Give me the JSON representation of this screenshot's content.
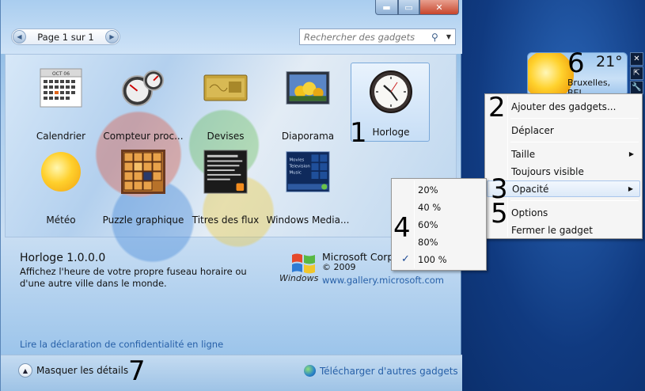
{
  "window": {
    "controls": {
      "minimize": "▬",
      "maximize": "▭",
      "close": "✕"
    }
  },
  "pager": {
    "label": "Page 1 sur 1"
  },
  "search": {
    "placeholder": "Rechercher des gadgets"
  },
  "gadgets": [
    {
      "label": "Calendrier",
      "icon": "calendar-icon",
      "month": "OCT 06"
    },
    {
      "label": "Compteur proc...",
      "icon": "cpu-meter-icon"
    },
    {
      "label": "Devises",
      "icon": "currency-card-icon"
    },
    {
      "label": "Diaporama",
      "icon": "slideshow-icon"
    },
    {
      "label": "Horloge",
      "icon": "clock-icon"
    },
    {
      "label": "Météo",
      "icon": "weather-sun-icon"
    },
    {
      "label": "Puzzle graphique",
      "icon": "picture-puzzle-icon"
    },
    {
      "label": "Titres des flux",
      "icon": "feed-headlines-icon"
    },
    {
      "label": "Windows Media...",
      "icon": "media-center-icon",
      "media_lines": [
        "Movies",
        "Television",
        "Music"
      ]
    }
  ],
  "details": {
    "title": "Horloge 1.0.0.0",
    "description": "Affichez l'heure de votre propre fuseau horaire ou d'une autre ville dans le monde.",
    "publisher": "Microsoft Corp",
    "year": "© 2009",
    "link": "www.gallery.microsoft.com",
    "ms_brand": "Windows"
  },
  "privacy_link": "Lire la déclaration de confidentialité en ligne",
  "footer": {
    "hide_details": "Masquer les détails",
    "download_more": "Télécharger d'autres gadgets"
  },
  "weather_gadget": {
    "temperature": "21°",
    "city": "Bruxelles, BEL"
  },
  "gadget_toolbar": {
    "close": "✕",
    "size": "⇱",
    "options": "🔧"
  },
  "context_menu": {
    "items": [
      {
        "label": "Ajouter des gadgets...",
        "submenu": false
      },
      {
        "label": "Déplacer",
        "submenu": false
      },
      {
        "label": "Taille",
        "submenu": true
      },
      {
        "label": "Toujours visible",
        "submenu": false
      },
      {
        "label": "Opacité",
        "submenu": true,
        "highlighted": true
      },
      {
        "label": "Options",
        "submenu": false
      },
      {
        "label": "Fermer le gadget",
        "submenu": false
      }
    ]
  },
  "opacity_menu": {
    "items": [
      "20%",
      "40 %",
      "60%",
      "80%",
      "100 %"
    ],
    "checked": "100 %"
  },
  "steps": [
    "1",
    "2",
    "3",
    "4",
    "5",
    "6",
    "7"
  ],
  "colors": {
    "link": "#2760a8",
    "menu_highlight": "#dce9f8",
    "desktop": "#12408a"
  }
}
